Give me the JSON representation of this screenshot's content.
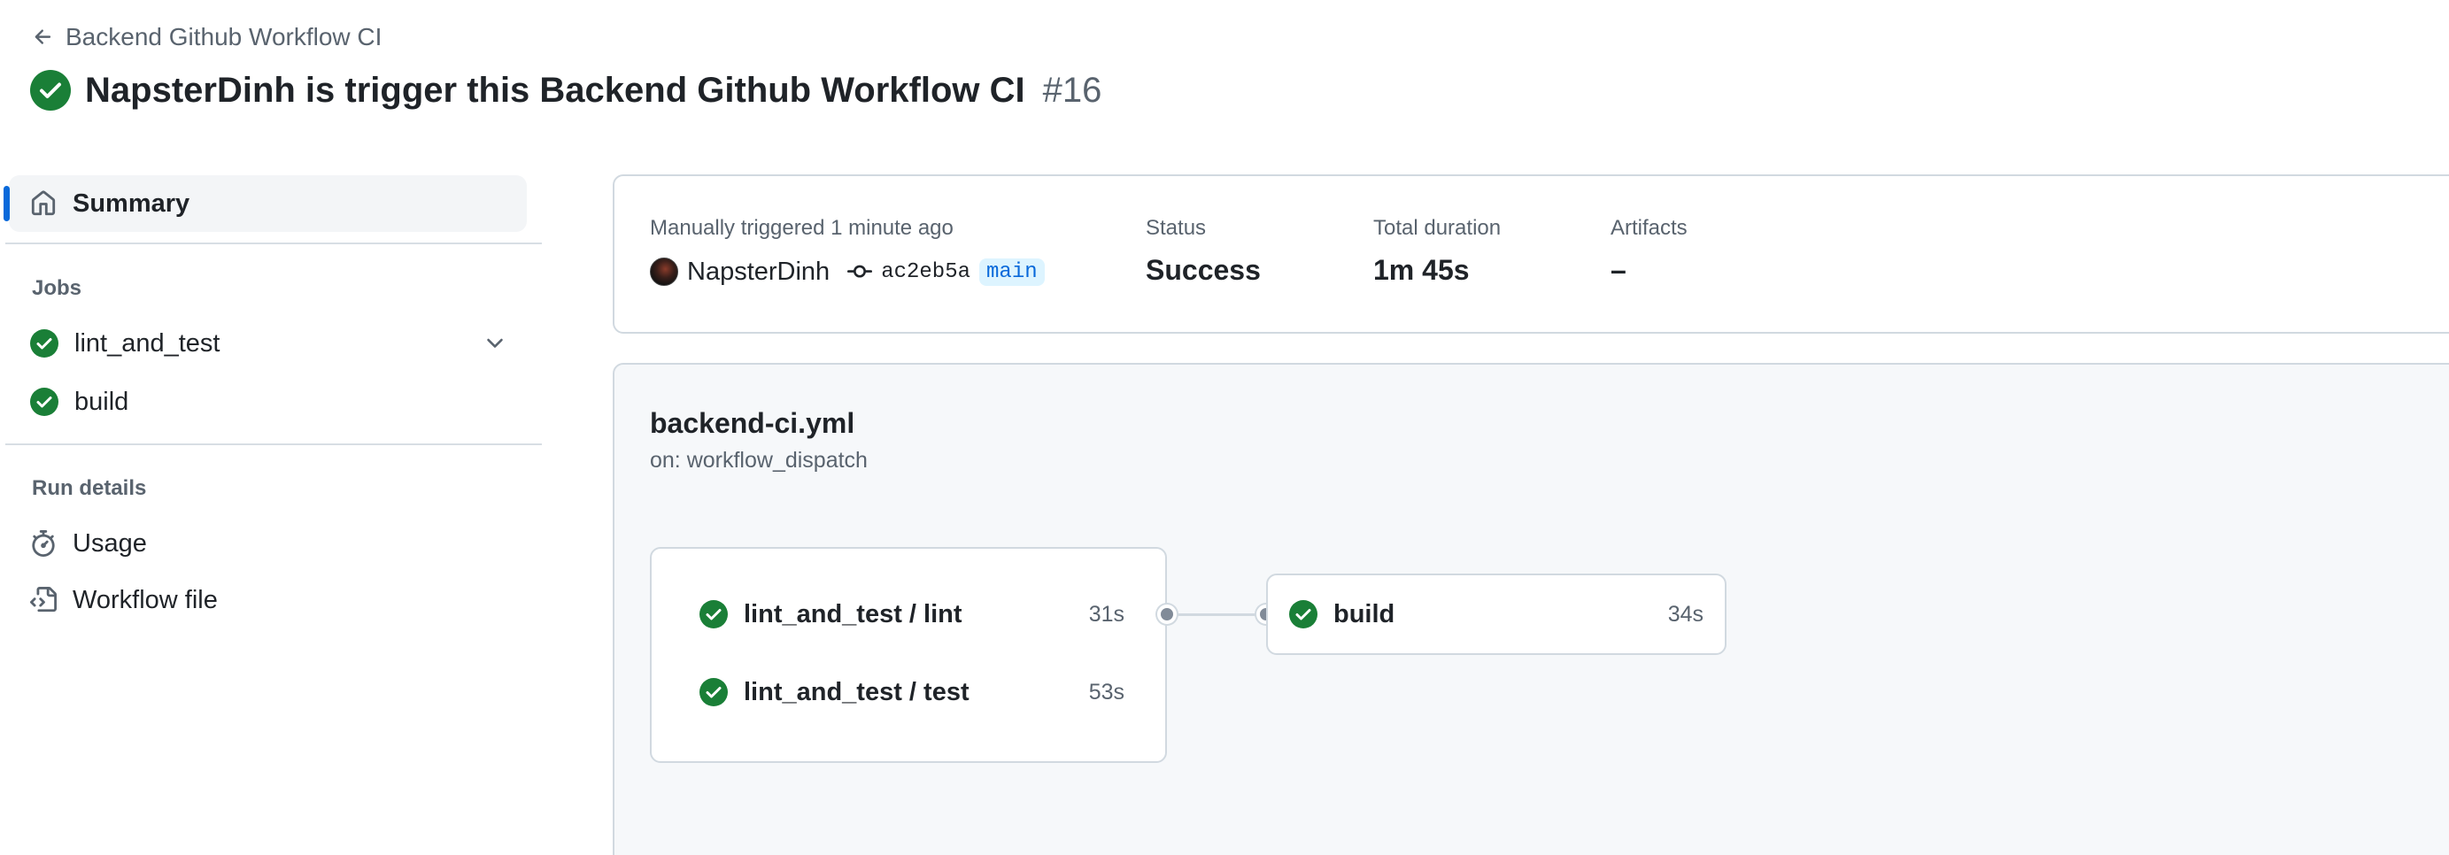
{
  "header": {
    "back_label": "Backend Github Workflow CI",
    "title": "NapsterDinh is trigger this Backend Github Workflow CI",
    "run_number": "#16"
  },
  "sidebar": {
    "summary_label": "Summary",
    "jobs_heading": "Jobs",
    "jobs": [
      {
        "label": "lint_and_test",
        "status": "success"
      },
      {
        "label": "build",
        "status": "success"
      }
    ],
    "run_details_heading": "Run details",
    "details": [
      {
        "label": "Usage",
        "icon": "stopwatch-icon"
      },
      {
        "label": "Workflow file",
        "icon": "file-code-icon"
      }
    ]
  },
  "summary": {
    "trigger_text": "Manually triggered 1 minute ago",
    "actor": "NapsterDinh",
    "commit": "ac2eb5a",
    "branch": "main",
    "status_label": "Status",
    "status_value": "Success",
    "duration_label": "Total duration",
    "duration_value": "1m 45s",
    "artifacts_label": "Artifacts",
    "artifacts_value": "–"
  },
  "workflow": {
    "file": "backend-ci.yml",
    "trigger": "on: workflow_dispatch",
    "group_jobs": [
      {
        "name": "lint_and_test / lint",
        "duration": "31s"
      },
      {
        "name": "lint_and_test / test",
        "duration": "53s"
      }
    ],
    "next_job": {
      "name": "build",
      "duration": "34s"
    }
  },
  "colors": {
    "success": "#1a7f37",
    "accent": "#0969da",
    "muted_text": "#59636e",
    "border": "#d1d9e0"
  }
}
